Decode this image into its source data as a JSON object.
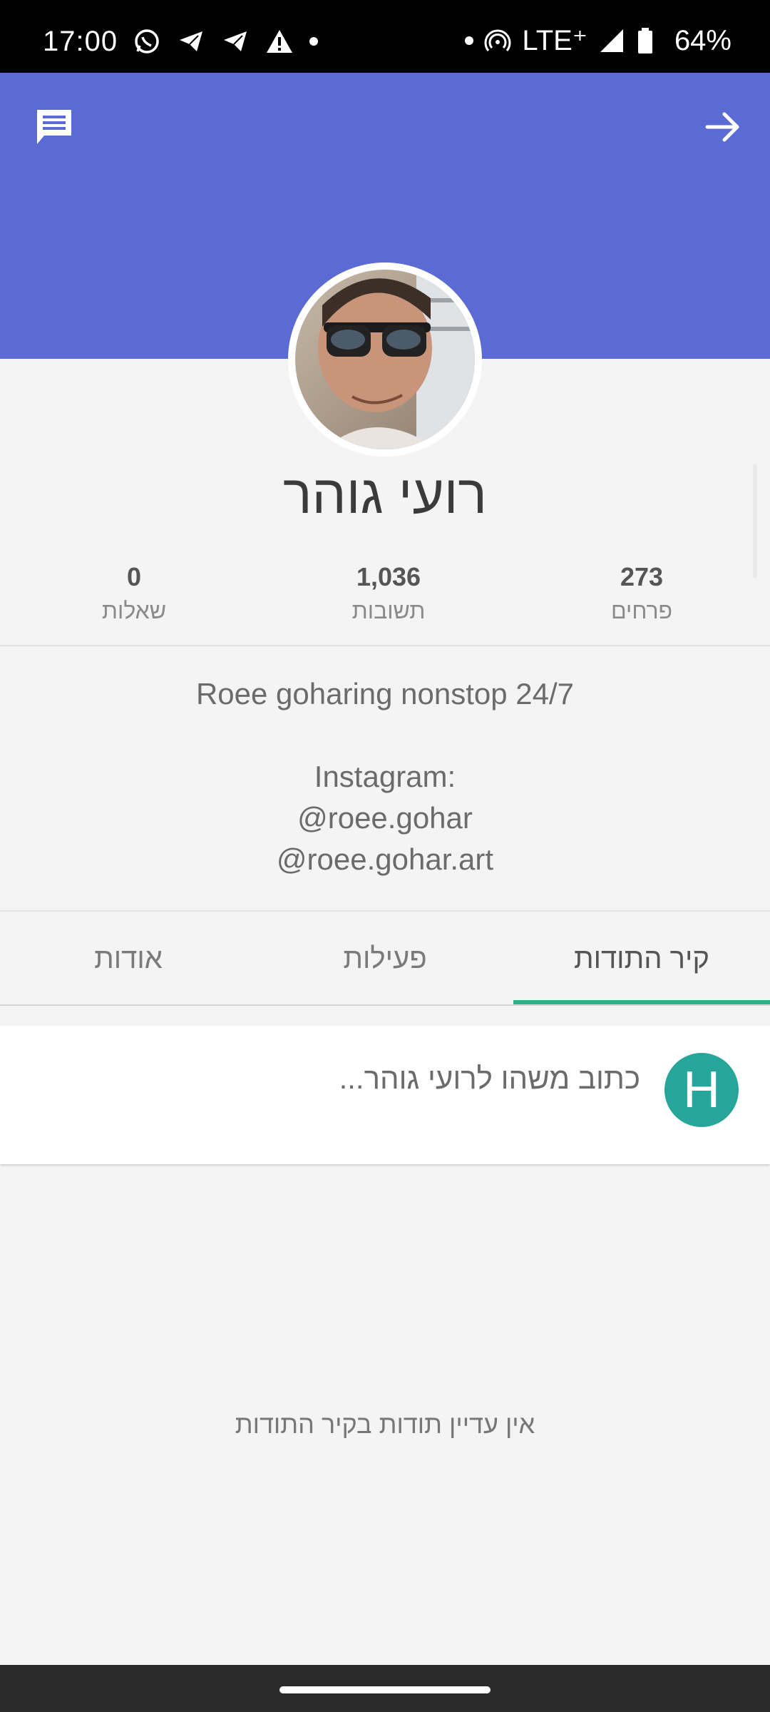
{
  "status_bar": {
    "time": "17:00",
    "network": "LTE⁺",
    "battery": "64%",
    "icons_left": [
      "whatsapp-icon",
      "telegram-icon",
      "telegram-icon",
      "warning-icon",
      "dot"
    ],
    "icons_right": [
      "dot",
      "hotspot-icon",
      "signal-icon",
      "battery-icon"
    ]
  },
  "header": {
    "color": "#5a6bd3",
    "left_icon": "message-icon",
    "right_icon": "arrow-forward-icon"
  },
  "profile": {
    "name": "רועי גוהר",
    "stats": [
      {
        "value": "273",
        "label": "פרחים"
      },
      {
        "value": "1,036",
        "label": "תשובות"
      },
      {
        "value": "0",
        "label": "שאלות"
      }
    ],
    "bio_lines": [
      "Roee goharing nonstop 24/7",
      "",
      "Instagram:",
      "@roee.gohar",
      "@roee.gohar.art"
    ]
  },
  "tabs": [
    {
      "label": "קיר התודות",
      "active": true
    },
    {
      "label": "פעילות",
      "active": false
    },
    {
      "label": "אודות",
      "active": false
    }
  ],
  "accent_color": "#27b48b",
  "compose": {
    "placeholder": "כתוב משהו לרועי גוהר...",
    "avatar_letter": "H",
    "avatar_color": "#26a69a"
  },
  "empty_message": "אין עדיין תודות בקיר התודות"
}
